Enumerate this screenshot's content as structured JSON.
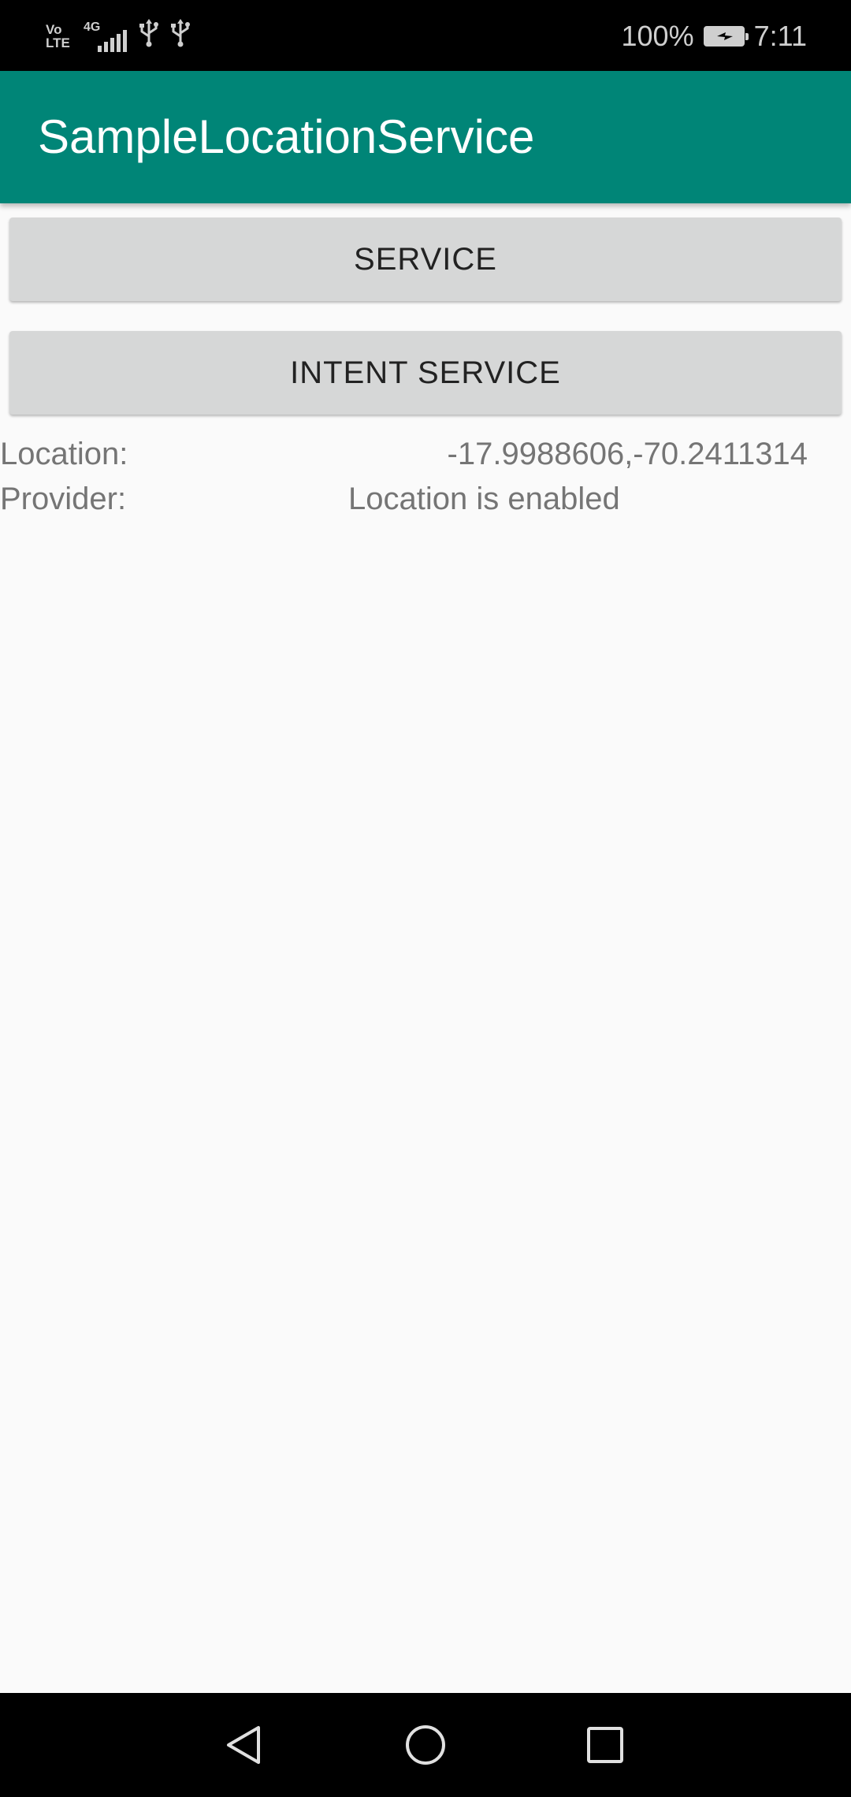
{
  "status_bar": {
    "volte_label": "Vo\nLTE",
    "network_label": "4G",
    "battery_percent": "100%",
    "time": "7:11",
    "icons": [
      "volte-icon",
      "signal-icon",
      "usb-icon",
      "usb-icon",
      "battery-charging-icon"
    ]
  },
  "app_bar": {
    "title": "SampleLocationService",
    "color": "#008577"
  },
  "buttons": {
    "service": "SERVICE",
    "intent_service": "INTENT SERVICE"
  },
  "info": {
    "location_label": "Location:",
    "location_value": "-17.9988606,-70.2411314",
    "provider_label": "Provider:",
    "provider_value": "Location is enabled"
  },
  "nav_bar": {
    "icons": [
      "back-icon",
      "home-icon",
      "recent-apps-icon"
    ]
  }
}
